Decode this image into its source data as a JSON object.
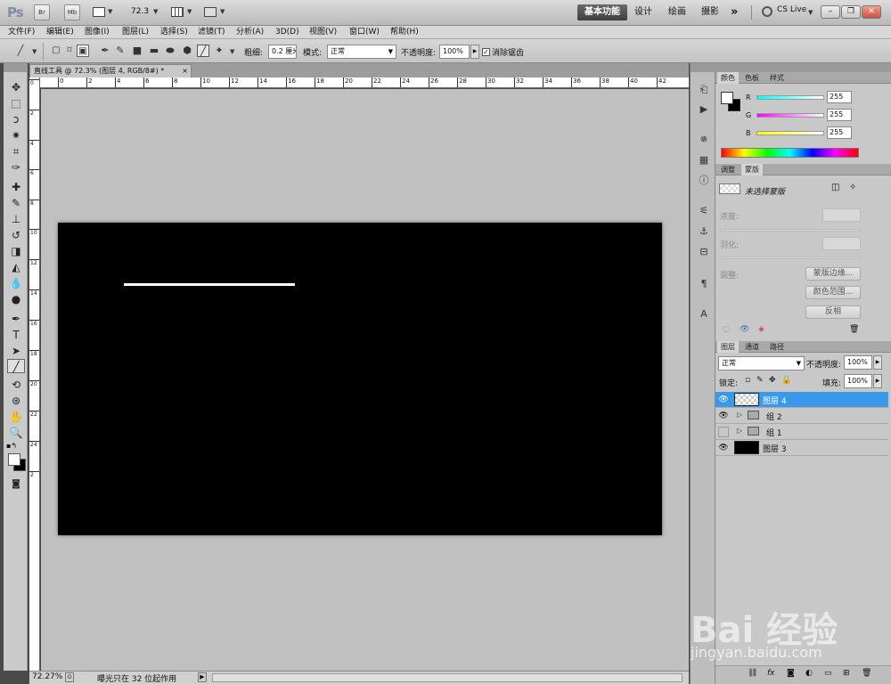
{
  "appbar": {
    "logo": "Ps",
    "btn_br": "Br",
    "btn_mb": "Mb",
    "zoom": "72.3",
    "ws_active": "基本功能",
    "ws_items": [
      "设计",
      "绘画",
      "摄影"
    ],
    "more": "»",
    "cslive": "CS Live"
  },
  "menubar": {
    "items": [
      "文件(F)",
      "编辑(E)",
      "图像(I)",
      "图层(L)",
      "选择(S)",
      "滤镜(T)",
      "分析(A)",
      "3D(D)",
      "视图(V)",
      "窗口(W)",
      "帮助(H)"
    ]
  },
  "options": {
    "weight_label": "粗细:",
    "weight_value": "0.2 厘米",
    "mode_label": "模式:",
    "mode_value": "正常",
    "opacity_label": "不透明度:",
    "opacity_value": "100%",
    "antialias_label": "消除锯齿"
  },
  "doc": {
    "tab_title": "直线工具 @ 72.3% (图层 4, RGB/8#) *",
    "close": "×"
  },
  "ruler": {
    "top_labels": [
      "0",
      "2",
      "4",
      "6",
      "8",
      "10",
      "12",
      "14",
      "16",
      "18",
      "20",
      "22",
      "24",
      "26",
      "28",
      "30",
      "32",
      "34",
      "36",
      "38",
      "40",
      "42"
    ],
    "left_labels": [
      "0",
      "2",
      "4",
      "6",
      "8",
      "10",
      "12",
      "14",
      "16",
      "18",
      "20",
      "22",
      "24",
      "2"
    ]
  },
  "status": {
    "zoom": "72.27%",
    "info": "曝光只在 32 位起作用"
  },
  "color_panel": {
    "tabs": [
      "颜色",
      "色板",
      "样式"
    ],
    "r_label": "R",
    "g_label": "G",
    "b_label": "B",
    "r": "255",
    "g": "255",
    "b": "255"
  },
  "mask_panel": {
    "tabs": [
      "调整",
      "蒙版"
    ],
    "title": "未选择蒙版",
    "density": "浓度:",
    "feather": "羽化:",
    "adjust": "调整:",
    "btn_edge": "蒙版边缘...",
    "btn_range": "颜色范围...",
    "btn_invert": "反相"
  },
  "layers_panel": {
    "tabs": [
      "图层",
      "通道",
      "路径"
    ],
    "blend": "正常",
    "opacity_label": "不透明度:",
    "opacity": "100%",
    "lock_label": "锁定:",
    "fill_label": "填充:",
    "fill": "100%",
    "layers": [
      {
        "name": "图层 4"
      },
      {
        "name": "组 2"
      },
      {
        "name": "组 1"
      },
      {
        "name": "图层 3"
      }
    ]
  },
  "watermark": {
    "line1": "Bai 经验",
    "line2": "jingyan.baidu.com"
  }
}
